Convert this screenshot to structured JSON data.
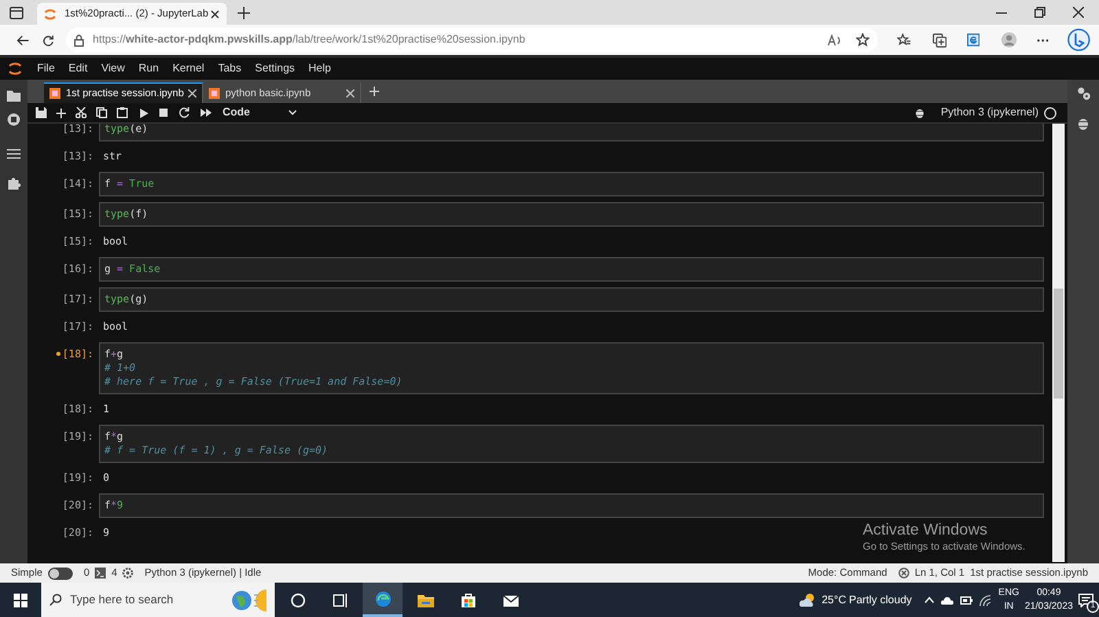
{
  "browser": {
    "tab_title": "1st%20practi... (2) - JupyterLab",
    "url": "https://**white-actor-pdqkm.pwskills.app**/lab/tree/work/1st%20practise%20session.ipynb"
  },
  "menu": [
    "File",
    "Edit",
    "View",
    "Run",
    "Kernel",
    "Tabs",
    "Settings",
    "Help"
  ],
  "doc_tabs": [
    {
      "label": "1st practise session.ipynb",
      "selected": true
    },
    {
      "label": "python basic.ipynb",
      "selected": false
    }
  ],
  "toolbar": {
    "cell_type": "Code",
    "kernel": "Python 3 (ipykernel)"
  },
  "cells": [
    {
      "kind": "input",
      "prompt": "[13]:",
      "modified": false,
      "lines": [
        [
          {
            "kind": "builtin",
            "text": "type"
          },
          {
            "kind": "name",
            "text": "(e)"
          }
        ]
      ]
    },
    {
      "kind": "output",
      "prompt": "[13]:",
      "text": "str"
    },
    {
      "kind": "input",
      "prompt": "[14]:",
      "modified": false,
      "lines": [
        [
          {
            "kind": "name",
            "text": "f "
          },
          {
            "kind": "op",
            "text": "="
          },
          {
            "kind": "keyword",
            "text": " True"
          }
        ]
      ]
    },
    {
      "kind": "input",
      "prompt": "[15]:",
      "modified": false,
      "lines": [
        [
          {
            "kind": "builtin",
            "text": "type"
          },
          {
            "kind": "name",
            "text": "(f)"
          }
        ]
      ]
    },
    {
      "kind": "output",
      "prompt": "[15]:",
      "text": "bool"
    },
    {
      "kind": "input",
      "prompt": "[16]:",
      "modified": false,
      "lines": [
        [
          {
            "kind": "name",
            "text": "g "
          },
          {
            "kind": "op",
            "text": "="
          },
          {
            "kind": "keyword",
            "text": " False"
          }
        ]
      ]
    },
    {
      "kind": "input",
      "prompt": "[17]:",
      "modified": false,
      "lines": [
        [
          {
            "kind": "builtin",
            "text": "type"
          },
          {
            "kind": "name",
            "text": "(g)"
          }
        ]
      ]
    },
    {
      "kind": "output",
      "prompt": "[17]:",
      "text": "bool"
    },
    {
      "kind": "input",
      "prompt": "[18]:",
      "modified": true,
      "lines": [
        [
          {
            "kind": "name",
            "text": "f"
          },
          {
            "kind": "op",
            "text": "+"
          },
          {
            "kind": "name",
            "text": "g"
          }
        ],
        [
          {
            "kind": "comment",
            "text": "# 1+0"
          }
        ],
        [
          {
            "kind": "comment",
            "text": "# here f = True , g = False (True=1 and False=0)"
          }
        ]
      ]
    },
    {
      "kind": "output",
      "prompt": "[18]:",
      "text": "1"
    },
    {
      "kind": "input",
      "prompt": "[19]:",
      "modified": false,
      "lines": [
        [
          {
            "kind": "name",
            "text": "f"
          },
          {
            "kind": "op",
            "text": "*"
          },
          {
            "kind": "name",
            "text": "g"
          }
        ],
        [
          {
            "kind": "comment",
            "text": "# f = True (f = 1) , g = False (g=0)"
          }
        ]
      ]
    },
    {
      "kind": "output",
      "prompt": "[19]:",
      "text": "0"
    },
    {
      "kind": "input",
      "prompt": "[20]:",
      "modified": false,
      "lines": [
        [
          {
            "kind": "name",
            "text": "f"
          },
          {
            "kind": "op",
            "text": "*"
          },
          {
            "kind": "number",
            "text": "9"
          }
        ]
      ]
    },
    {
      "kind": "output",
      "prompt": "[20]:",
      "text": "9"
    }
  ],
  "status_bar": {
    "simple_label": "Simple",
    "simple_on": false,
    "terminals": "0",
    "kernels": "4",
    "kernel_status": "Python 3 (ipykernel) | Idle",
    "mode": "Mode: Command",
    "position": "Ln 1, Col 1",
    "file": "1st practise session.ipynb"
  },
  "activation": {
    "title": "Activate Windows",
    "subtitle": "Go to Settings to activate Windows."
  },
  "taskbar": {
    "search_placeholder": "Type here to search",
    "apps": [
      {
        "kind": "cortana",
        "active": false
      },
      {
        "kind": "taskview",
        "active": false
      },
      {
        "kind": "edge",
        "active": true
      },
      {
        "kind": "explorer",
        "active": false
      },
      {
        "kind": "store",
        "active": false
      },
      {
        "kind": "mail",
        "active": false
      }
    ],
    "temperature": "25°C",
    "weather": "Partly cloudy",
    "language": "ENG",
    "region": "IN",
    "time": "00:49",
    "date": "21/03/2023",
    "notifications": "1"
  }
}
